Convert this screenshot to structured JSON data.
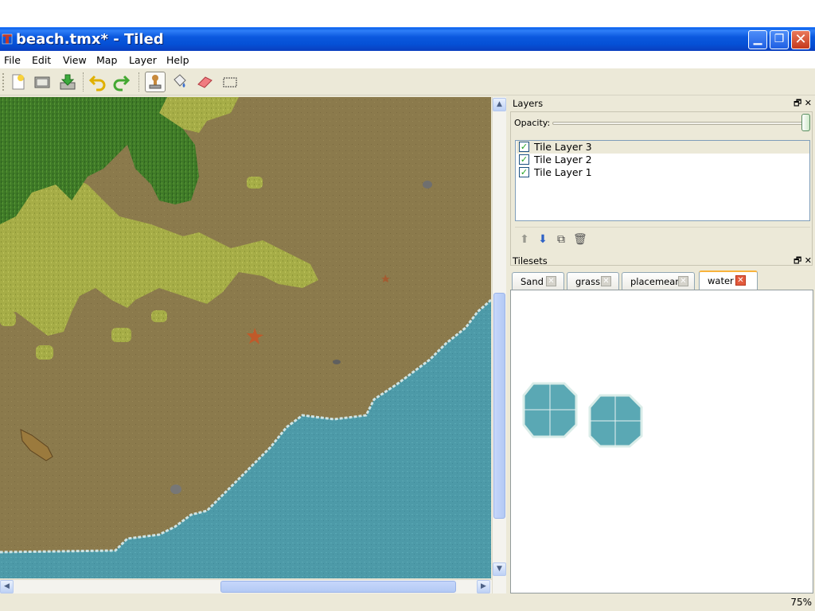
{
  "window": {
    "title": "beach.tmx* - Tiled"
  },
  "menu": [
    "File",
    "Edit",
    "View",
    "Map",
    "Layer",
    "Help"
  ],
  "toolbar": {
    "tools": [
      "new-icon",
      "open-icon",
      "save-icon",
      "undo-icon",
      "redo-icon",
      "stamp-brush-icon",
      "bucket-fill-icon",
      "eraser-icon",
      "rectangle-select-icon"
    ],
    "active_tool": "stamp-brush-icon"
  },
  "layers_panel": {
    "title": "Layers",
    "opacity_label": "Opacity:",
    "opacity_value": 1.0,
    "layers": [
      {
        "name": "Tile Layer 3",
        "visible": true,
        "selected": true
      },
      {
        "name": "Tile Layer 2",
        "visible": true,
        "selected": false
      },
      {
        "name": "Tile Layer 1",
        "visible": true,
        "selected": false
      }
    ],
    "tools": [
      "move-up-icon",
      "move-down-icon",
      "duplicate-icon",
      "delete-icon"
    ]
  },
  "tilesets_panel": {
    "title": "Tilesets",
    "tabs": [
      {
        "label": "Sand",
        "active": false
      },
      {
        "label": "grass",
        "active": false
      },
      {
        "label": "placemeant",
        "active": false
      },
      {
        "label": "water",
        "active": true
      }
    ]
  },
  "status": {
    "zoom": "75%"
  },
  "colors": {
    "sand": "#8b7a4c",
    "grass_dark": "#3f7a27",
    "grass_light": "#a6ad47",
    "water": "#4d9aa8",
    "titlebar": "#0b58de"
  }
}
